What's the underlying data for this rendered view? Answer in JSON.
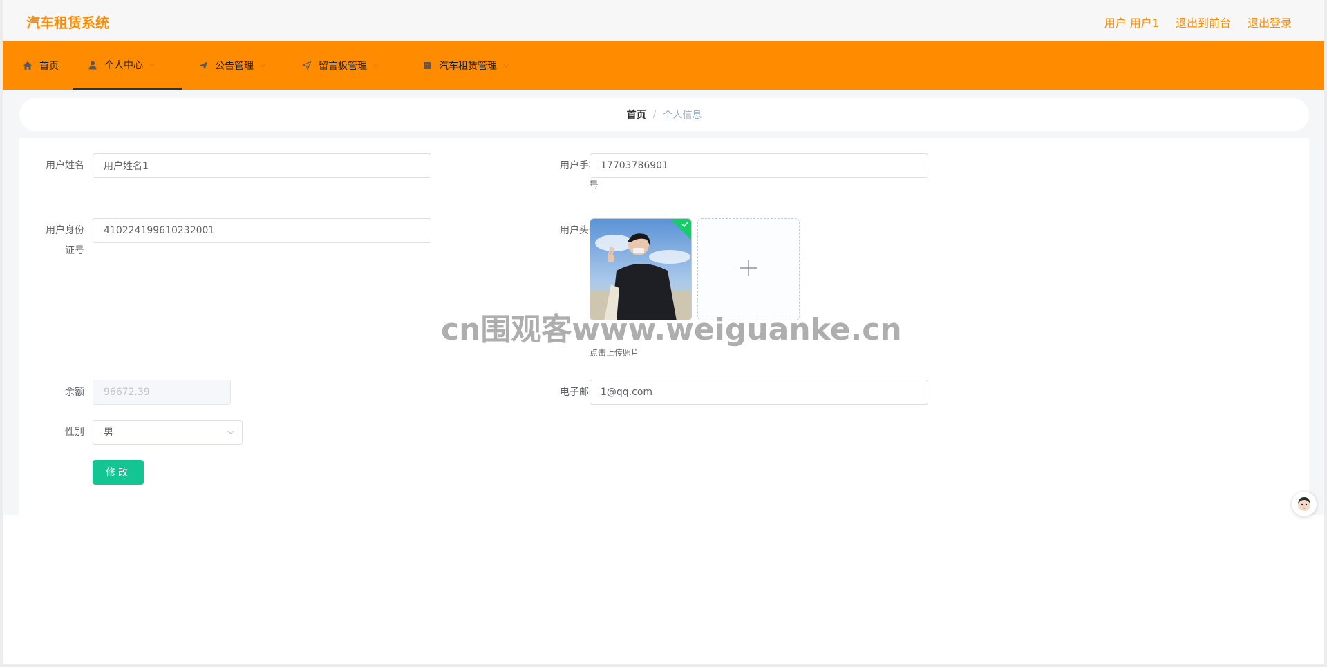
{
  "header": {
    "title": "汽车租赁系统",
    "user_label": "用户 用户1",
    "front_link": "退出到前台",
    "logout_link": "退出登录"
  },
  "nav": {
    "items": [
      {
        "label": "首页",
        "icon": "home-icon"
      },
      {
        "label": "个人中心",
        "icon": "user-icon"
      },
      {
        "label": "公告管理",
        "icon": "send-icon"
      },
      {
        "label": "留言板管理",
        "icon": "navigation-icon"
      },
      {
        "label": "汽车租赁管理",
        "icon": "book-icon"
      }
    ],
    "active_index": 1
  },
  "breadcrumb": {
    "home": "首页",
    "separator": "/",
    "current": "个人信息"
  },
  "form": {
    "name_label": "用户姓名",
    "name_value": "用户姓名1",
    "phone_label_line1": "用户手机",
    "phone_label_line2": "号",
    "phone_value": "17703786901",
    "idcard_label_line1": "用户身份",
    "idcard_label_line2": "证号",
    "idcard_value": "410224199610232001",
    "avatar_label": "用户头像",
    "upload_tip": "点击上传照片",
    "balance_label": "余额",
    "balance_value": "96672.39",
    "email_label": "电子邮箱",
    "email_value": "1@qq.com",
    "gender_label": "性别",
    "gender_value": "男",
    "submit_label": "修改"
  },
  "watermark": "cn围观客www.weiguanke.cn",
  "colors": {
    "accent": "#ff8c00",
    "success": "#13ce66",
    "button": "#13c592"
  }
}
